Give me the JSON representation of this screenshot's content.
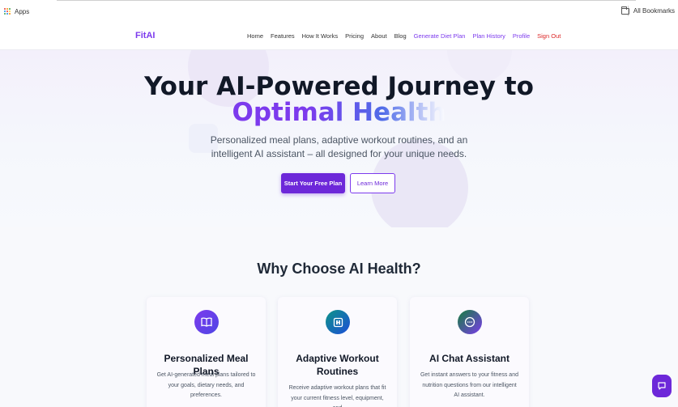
{
  "browser": {
    "apps_label": "Apps",
    "all_bookmarks_label": "All Bookmarks"
  },
  "nav": {
    "logo": "FitAI",
    "links": [
      "Home",
      "Features",
      "How It Works",
      "Pricing",
      "About",
      "Blog",
      "Generate Diet Plan",
      "Plan History",
      "Profile",
      "Sign Out"
    ]
  },
  "hero": {
    "title_line1": "Your AI-Powered Journey to",
    "title_line2": "Optimal Health",
    "subtitle": "Personalized meal plans, adaptive workout routines, and an intelligent AI assistant – all designed for your unique needs.",
    "primary_button": "Start Your Free Plan",
    "secondary_button": "Learn More"
  },
  "features": {
    "title": "Why Choose AI Health?",
    "cards": [
      {
        "title": "Personalized Meal Plans",
        "description": "Get AI-generated meal plans tailored to your goals, dietary needs, and preferences.",
        "icon": "book-icon"
      },
      {
        "title": "Adaptive Workout Routines",
        "description": "Receive adaptive workout plans that fit your current fitness level, equipment, and",
        "icon": "dumbbell-icon"
      },
      {
        "title": "AI Chat Assistant",
        "description": "Get instant answers to your fitness and nutrition questions from our intelligent AI assistant.",
        "icon": "chat-icon"
      }
    ]
  },
  "colors": {
    "brand_purple": "#7c3aed",
    "button_purple": "#6d28d9",
    "sign_out_red": "#dc2626"
  }
}
